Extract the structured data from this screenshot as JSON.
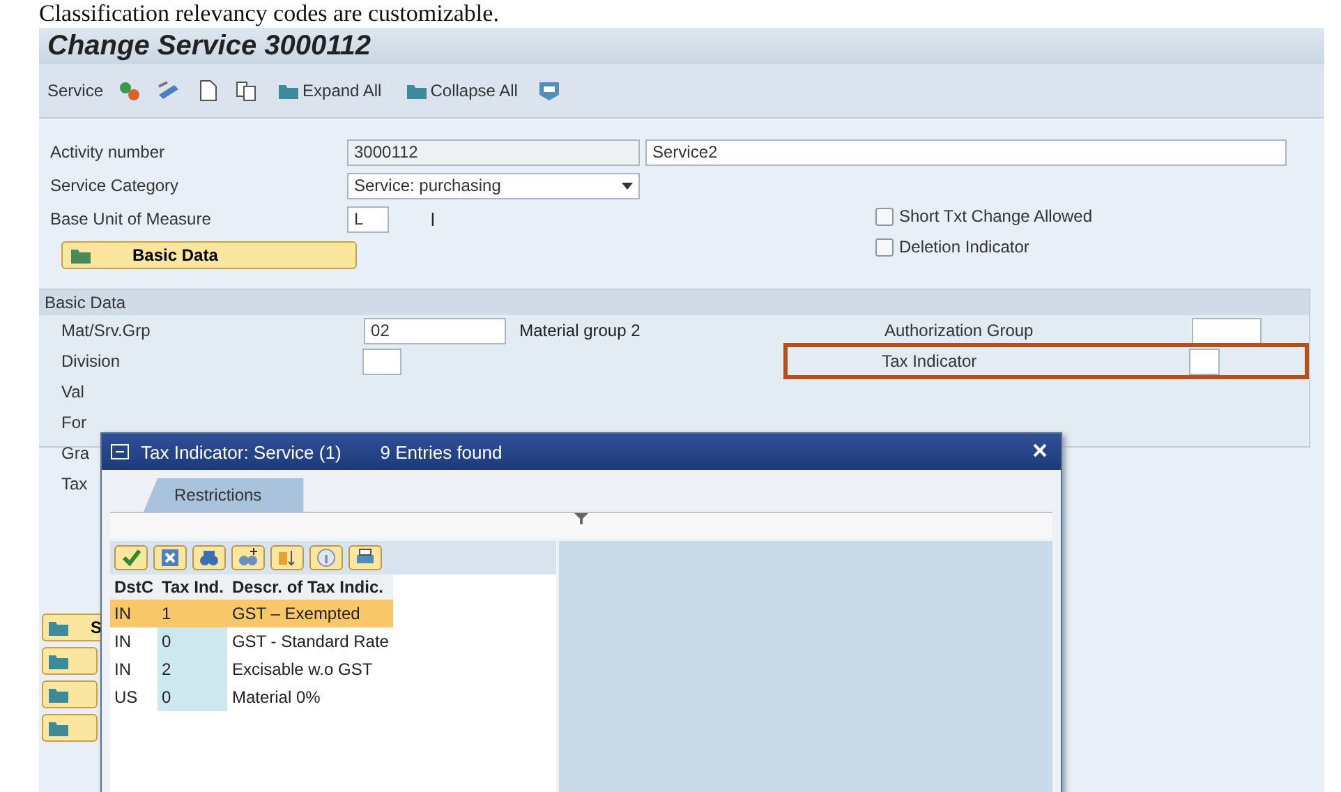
{
  "caption": "Classification relevancy codes are customizable.",
  "window": {
    "title": "Change Service 3000112"
  },
  "toolbar": [
    {
      "kind": "menu",
      "label": "Service"
    },
    {
      "kind": "icon"
    },
    {
      "kind": "icon"
    },
    {
      "kind": "icon"
    },
    {
      "kind": "icon"
    },
    {
      "kind": "button",
      "label": "Expand All"
    },
    {
      "kind": "button",
      "label": "Collapse All"
    },
    {
      "kind": "icon"
    }
  ],
  "header_fields": [
    {
      "kind": "text",
      "label": "Activity number",
      "value": "3000112",
      "description": "Service2"
    },
    {
      "kind": "dropdown",
      "label": "Service Category",
      "value": "Service: purchasing"
    },
    {
      "kind": "unit",
      "label": "Base Unit of Measure",
      "value": "L",
      "description": "l"
    }
  ],
  "checkboxes": [
    {
      "label": "Short Txt Change Allowed",
      "checked": false
    },
    {
      "label": "Deletion Indicator",
      "checked": false
    }
  ],
  "tab_button": {
    "label": "Basic Data",
    "selected": true
  },
  "group": {
    "title": "Basic Data",
    "rows": [
      {
        "label": "Mat/Srv.Grp",
        "value": "02",
        "description": "Material group 2",
        "right_label": "Authorization Group",
        "right_highlighted": false
      },
      {
        "label": "Division",
        "right_label": "Tax Indicator",
        "right_highlighted": true
      },
      {
        "label": "Val"
      },
      {
        "label": "For"
      },
      {
        "label": "Gra"
      },
      {
        "label": "Tax"
      }
    ]
  },
  "side_tabs": [
    {
      "kind": "labeled",
      "label": "S"
    },
    {
      "kind": "plain"
    },
    {
      "kind": "plain"
    },
    {
      "kind": "plain"
    }
  ],
  "popup": {
    "title": "Tax Indicator: Service (1)",
    "status": "9 Entries found",
    "tabs": [
      {
        "label": "Restrictions",
        "selected": true
      }
    ],
    "columns": [
      "DstC",
      "Tax Ind.",
      "Descr. of Tax Indic."
    ],
    "rows": [
      {
        "cells": [
          "IN",
          "1",
          "GST – Exempted"
        ],
        "selected": true
      },
      {
        "cells": [
          "IN",
          "0",
          "GST - Standard Rate"
        ],
        "selected": false
      },
      {
        "cells": [
          "IN",
          "2",
          "Excisable w.o GST"
        ],
        "selected": false
      },
      {
        "cells": [
          "US",
          "0",
          "Material 0%"
        ],
        "selected": false
      }
    ]
  }
}
